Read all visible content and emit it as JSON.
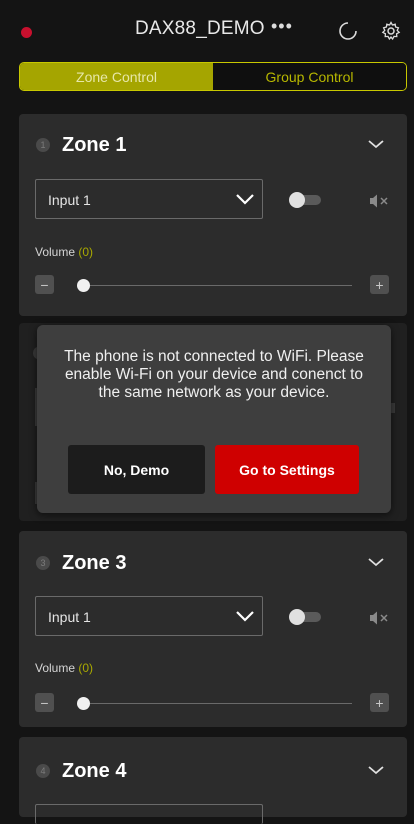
{
  "header": {
    "title": "DAX88_DEMO",
    "more_glyph": "•••",
    "status_dot_color": "#c8102e",
    "icons": [
      "status-dot",
      "more-icon",
      "refresh-icon",
      "gear-icon"
    ]
  },
  "tabs": [
    {
      "label": "Zone Control",
      "active": true
    },
    {
      "label": "Group Control",
      "active": false
    }
  ],
  "zones": [
    {
      "number": "1",
      "name": "Zone 1",
      "input": "Input 1",
      "volume_label": "Volume",
      "volume_value": "(0)",
      "minus": "−",
      "plus": "+"
    },
    {
      "number": "3",
      "name": "Zone 3",
      "input": "Input 1",
      "volume_label": "Volume",
      "volume_value": "(0)",
      "minus": "−",
      "plus": "+"
    },
    {
      "number": "4",
      "name": "Zone 4"
    }
  ],
  "dialog": {
    "message": "The phone is not connected to WiFi. Please enable Wi-Fi on your device and conenct to the same network as your device.",
    "cancel_label": "No, Demo",
    "confirm_label": "Go to Settings"
  },
  "colors": {
    "accent": "#a5a500",
    "accent_text": "#b7b700",
    "danger": "#cf0000",
    "card": "#2c2c2c",
    "background": "#141414"
  }
}
